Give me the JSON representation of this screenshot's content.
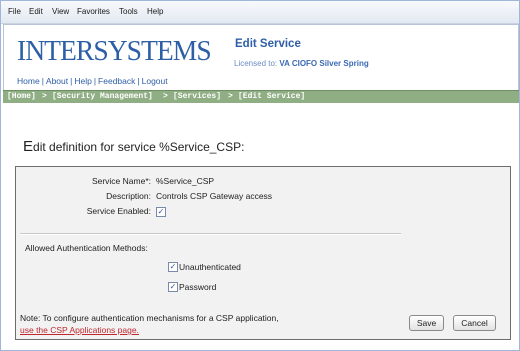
{
  "menu": [
    "File",
    "Edit",
    "View",
    "Favorites",
    "Tools",
    "Help"
  ],
  "header": {
    "logo": "INTERSYSTEMS",
    "title": "Edit Service",
    "licensed_label": "Licensed to:",
    "licensed_value": "VA CIOFO Silver Spring",
    "links": [
      "Home",
      "About",
      "Help",
      "Feedback",
      "Logout"
    ]
  },
  "breadcrumb": [
    "[Home]",
    ">",
    "[Security Management]",
    ">",
    "[Services]",
    ">",
    "[Edit Service]"
  ],
  "heading": {
    "first": "E",
    "rest": "dit definition for service %Service_CSP:"
  },
  "form": {
    "service_name_label": "Service Name*:",
    "service_name_value": "%Service_CSP",
    "description_label": "Description:",
    "description_value": "Controls CSP Gateway access",
    "enabled_label": "Service Enabled:",
    "enabled": true,
    "auth_label": "Allowed Authentication Methods:",
    "auth_methods": [
      {
        "label": "Unauthenticated",
        "checked": true
      },
      {
        "label": "Password",
        "checked": true
      }
    ],
    "note": "Note: To configure authentication mechanisms for a CSP application,",
    "note_link": "use the CSP Applications page.",
    "save_label": "Save",
    "cancel_label": "Cancel"
  }
}
